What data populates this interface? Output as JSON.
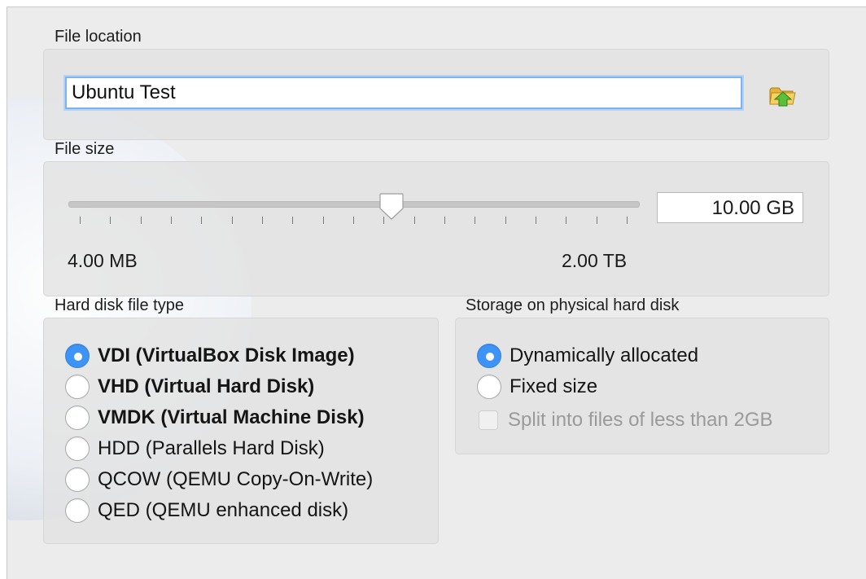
{
  "file_location": {
    "label": "File location",
    "value": "Ubuntu Test",
    "browse_icon": "folder-open-icon"
  },
  "file_size": {
    "label": "File size",
    "value": "10.00 GB",
    "min_label": "4.00 MB",
    "max_label": "2.00 TB",
    "slider_fraction": 0.59,
    "tick_count": 19
  },
  "disk_type": {
    "label": "Hard disk file type",
    "options": [
      {
        "label": "VDI (VirtualBox Disk Image)",
        "selected": true,
        "bold": true
      },
      {
        "label": "VHD (Virtual Hard Disk)",
        "selected": false,
        "bold": true
      },
      {
        "label": "VMDK (Virtual Machine Disk)",
        "selected": false,
        "bold": true
      },
      {
        "label": "HDD (Parallels Hard Disk)",
        "selected": false,
        "bold": false
      },
      {
        "label": "QCOW (QEMU Copy-On-Write)",
        "selected": false,
        "bold": false
      },
      {
        "label": "QED (QEMU enhanced disk)",
        "selected": false,
        "bold": false
      }
    ]
  },
  "storage": {
    "label": "Storage on physical hard disk",
    "options": [
      {
        "label": "Dynamically allocated",
        "selected": true
      },
      {
        "label": "Fixed size",
        "selected": false
      }
    ],
    "split_label": "Split into files of less than 2GB",
    "split_checked": false,
    "split_enabled": false
  },
  "colors": {
    "accent": "#3d94f6",
    "focus_ring": "#7fb3ee",
    "panel": "#e2e2e2"
  }
}
